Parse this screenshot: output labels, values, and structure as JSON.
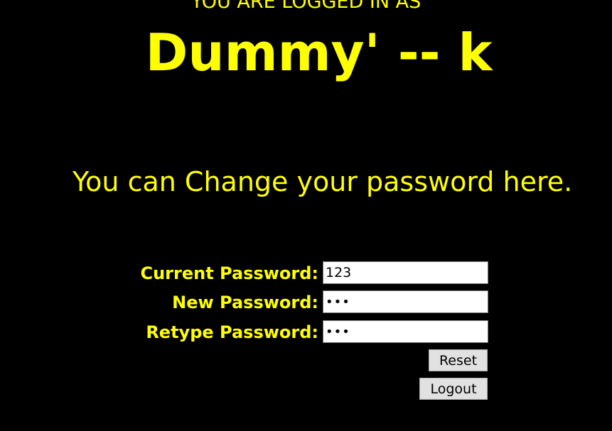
{
  "header": {
    "logged_in_label": "YOU ARE LOGGED IN AS",
    "username": "Dummy' -- k"
  },
  "message": "You can Change your password here.",
  "form": {
    "current_password": {
      "label": "Current Password:",
      "value": "123"
    },
    "new_password": {
      "label": "New Password:",
      "value": "abc"
    },
    "retype_password": {
      "label": "Retype Password:",
      "value": "abc"
    },
    "reset_label": "Reset",
    "logout_label": "Logout"
  },
  "colors": {
    "background": "#000000",
    "text": "#ffff00"
  }
}
